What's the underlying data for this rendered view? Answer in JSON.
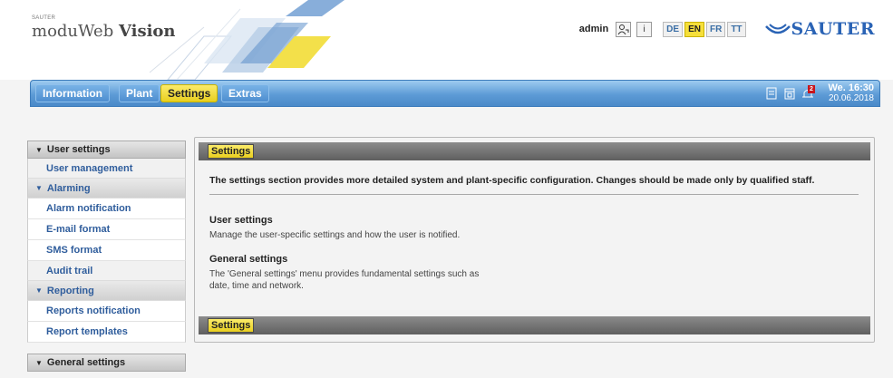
{
  "header": {
    "brand_small": "SAUTER",
    "brand_prefix": "moduWeb ",
    "brand_suffix": "Vision",
    "user": "admin",
    "user_icon": "user-settings-icon",
    "info_icon": "info-icon",
    "languages": [
      "DE",
      "EN",
      "FR",
      "TT"
    ],
    "active_language": "EN",
    "logo_text": "SAUTER",
    "logo_icon": "sauter-logo-swoosh-icon"
  },
  "nav": {
    "tabs": [
      "Information",
      "Plant",
      "Settings",
      "Extras"
    ],
    "active_tab": "Settings",
    "icons": [
      "document-icon",
      "calendar-icon",
      "alarm-bell-icon"
    ],
    "alarm_count": "2",
    "day_time": "We. 16:30",
    "date": "20.06.2018"
  },
  "sidebar": {
    "user_settings": "User settings",
    "user_management": "User management",
    "alarming": "Alarming",
    "alarm_notification": "Alarm notification",
    "email_format": "E-mail format",
    "sms_format": "SMS format",
    "audit_trail": "Audit trail",
    "reporting": "Reporting",
    "reports_notification": "Reports notification",
    "report_templates": "Report templates",
    "general_settings": "General settings"
  },
  "content": {
    "header_label": "Settings",
    "footer_label": "Settings",
    "intro": "The settings section provides more detailed system and plant-specific configuration. Changes should be made only by qualified staff.",
    "sections": [
      {
        "title": "User settings",
        "text": "Manage the user-specific settings and how the user is notified."
      },
      {
        "title": "General settings",
        "text_line1": "The 'General settings' menu provides fundamental settings such as",
        "text_line2": "date, time and network."
      }
    ]
  },
  "colors": {
    "accent_yellow": "#f6df3a",
    "nav_blue": "#5d9bd6",
    "link_blue": "#2f5d9c",
    "bar_gray": "#6e6e6e"
  }
}
